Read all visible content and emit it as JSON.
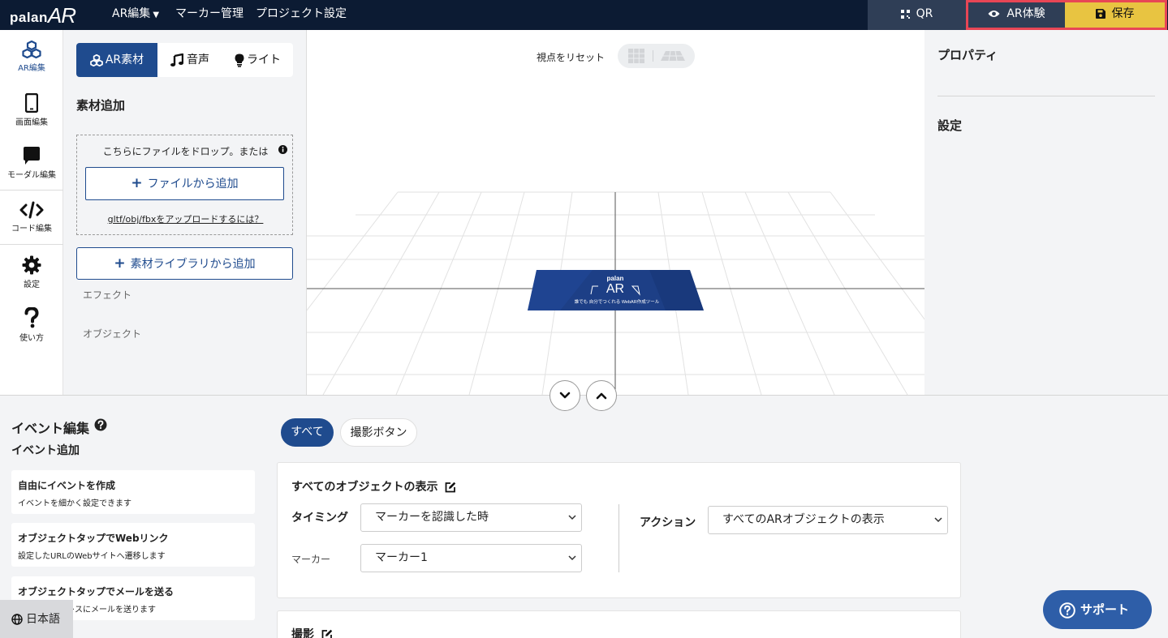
{
  "header": {
    "logo_small": "palan",
    "logo_big": "AR",
    "nav": {
      "ar_edit": "AR編集",
      "marker_manage": "マーカー管理",
      "project_settings": "プロジェクト設定"
    },
    "qr_label": "QR",
    "ar_try_label": "AR体験",
    "save_label": "保存"
  },
  "rail": {
    "items": [
      {
        "label": "AR編集",
        "icon": "cubes-icon"
      },
      {
        "label": "画面編集",
        "icon": "smartphone-icon"
      },
      {
        "label": "モーダル編集",
        "icon": "chat-bubble-icon"
      },
      {
        "label": "コード編集",
        "icon": "code-icon"
      },
      {
        "label": "設定",
        "icon": "gear-icon"
      },
      {
        "label": "使い方",
        "icon": "question-icon"
      }
    ]
  },
  "assets": {
    "tabs": {
      "ar": "AR素材",
      "sound": "音声",
      "light": "ライト"
    },
    "add_title": "素材追加",
    "drop_text": "こちらにファイルをドロップ。または",
    "file_add": "ファイルから追加",
    "upload_help": "gltf/obj/fbxをアップロードするには？",
    "library_add": "素材ライブラリから追加",
    "categories": {
      "effect": "エフェクト",
      "object": "オブジェクト"
    }
  },
  "viewport": {
    "reset_view": "視点をリセット",
    "marker_caption": "誰でも 自分でつくれる WebAR作成ツール"
  },
  "properties": {
    "title": "プロパティ",
    "settings": "設定"
  },
  "events": {
    "title": "イベント編集",
    "add_title": "イベント追加",
    "cards": [
      {
        "title": "自由にイベントを作成",
        "desc": "イベントを細かく設定できます"
      },
      {
        "title": "オブジェクトタップでWebリンク",
        "desc": "設定したURLのWebサイトへ遷移します"
      },
      {
        "title": "オブジェクトタップでメールを送る",
        "desc": "設定したアドレスにメールを送ります"
      }
    ],
    "filters": {
      "all": "すべて",
      "shoot": "撮影ボタン"
    },
    "main_event": {
      "name": "すべてのオブジェクトの表示",
      "timing_label": "タイミング",
      "timing_value": "マーカーを認識した時",
      "marker_label": "マーカー",
      "marker_value": "マーカー1",
      "action_label": "アクション",
      "action_value": "すべてのARオブジェクトの表示"
    },
    "second_event": {
      "name": "撮影"
    }
  },
  "language": "日本語",
  "support": "サポート",
  "colors": {
    "navy": "#0c1b33",
    "primary": "#1f4b8e",
    "save_yellow": "#e8c441",
    "highlight_red": "#e84655"
  }
}
